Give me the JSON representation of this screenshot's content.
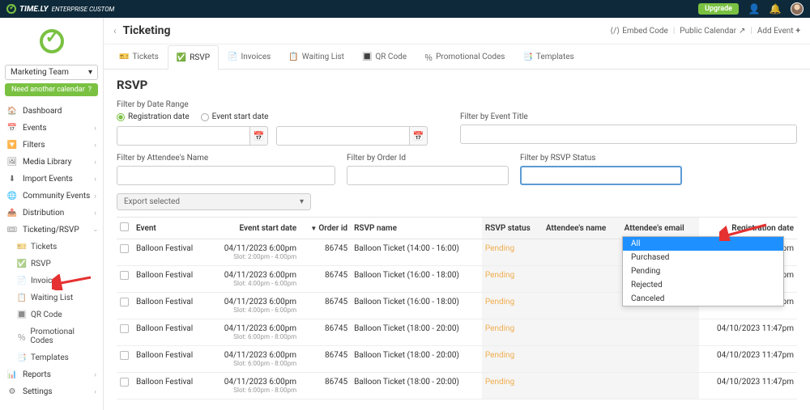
{
  "topbar": {
    "brand": "TIME.LY",
    "brand_sub": "ENTERPRISE CUSTOM",
    "upgrade": "Upgrade"
  },
  "sidebar": {
    "team": "Marketing Team",
    "need_calendar": "Need another calendar",
    "items": [
      {
        "icon": "🏠",
        "label": "Dashboard"
      },
      {
        "icon": "📅",
        "label": "Events",
        "chev": true
      },
      {
        "icon": "🔽",
        "label": "Filters",
        "chev": true
      },
      {
        "icon": "🖼",
        "label": "Media Library",
        "chev": true
      },
      {
        "icon": "⬇",
        "label": "Import Events",
        "chev": true
      },
      {
        "icon": "🌐",
        "label": "Community Events",
        "chev": true
      },
      {
        "icon": "📤",
        "label": "Distribution",
        "chev": true
      },
      {
        "icon": "🎟",
        "label": "Ticketing/RSVP",
        "chev": true,
        "expanded": true
      },
      {
        "icon": "📊",
        "label": "Reports",
        "chev": true
      },
      {
        "icon": "⚙",
        "label": "Settings",
        "chev": true
      }
    ],
    "sub_items": [
      {
        "icon": "🎫",
        "label": "Tickets"
      },
      {
        "icon": "✅",
        "label": "RSVP"
      },
      {
        "icon": "📄",
        "label": "Invoices"
      },
      {
        "icon": "📋",
        "label": "Waiting List"
      },
      {
        "icon": "🔳",
        "label": "QR Code"
      },
      {
        "icon": "％",
        "label": "Promotional Codes"
      },
      {
        "icon": "📑",
        "label": "Templates"
      }
    ]
  },
  "page": {
    "title": "Ticketing",
    "embed": "Embed Code",
    "public": "Public Calendar",
    "add": "Add Event"
  },
  "tabs": [
    {
      "icon": "🎫",
      "label": "Tickets"
    },
    {
      "icon": "✅",
      "label": "RSVP",
      "active": true
    },
    {
      "icon": "📄",
      "label": "Invoices"
    },
    {
      "icon": "📋",
      "label": "Waiting List"
    },
    {
      "icon": "🔳",
      "label": "QR Code"
    },
    {
      "icon": "％",
      "label": "Promotional Codes"
    },
    {
      "icon": "📑",
      "label": "Templates"
    }
  ],
  "filters": {
    "section": "RSVP",
    "date_range": "Filter by Date Range",
    "reg": "Registration date",
    "start": "Event start date",
    "event_title": "Filter by Event Title",
    "attendee": "Filter by Attendee's Name",
    "order": "Filter by Order Id",
    "status": "Filter by RSVP Status",
    "export": "Export selected",
    "status_options": [
      "All",
      "Purchased",
      "Pending",
      "Rejected",
      "Canceled"
    ]
  },
  "table": {
    "cols": [
      "",
      "Event",
      "Event start date",
      "Order id",
      "RSVP name",
      "RSVP status",
      "Attendee's name",
      "Attendee's email",
      "Registration date"
    ],
    "rows": [
      {
        "event": "Balloon Festival",
        "date": "04/11/2023 6:00pm",
        "slot": "Slot: 2:00pm - 4:00pm",
        "order": "86745",
        "rsvp": "Balloon Ticket (14:00 - 16:00)",
        "status": "Pending",
        "reg": "04/10/2023 11:47pm"
      },
      {
        "event": "Balloon Festival",
        "date": "04/11/2023 6:00pm",
        "slot": "Slot: 4:00pm - 6:00pm",
        "order": "86745",
        "rsvp": "Balloon Ticket (16:00 - 18:00)",
        "status": "Pending",
        "reg": "04/10/2023 11:47pm"
      },
      {
        "event": "Balloon Festival",
        "date": "04/11/2023 6:00pm",
        "slot": "Slot: 4:00pm - 6:00pm",
        "order": "86745",
        "rsvp": "Balloon Ticket (16:00 - 18:00)",
        "status": "Pending",
        "reg": "04/10/2023 11:47pm"
      },
      {
        "event": "Balloon Festival",
        "date": "04/11/2023 6:00pm",
        "slot": "Slot: 6:00pm - 8:00pm",
        "order": "86745",
        "rsvp": "Balloon Ticket (18:00 - 20:00)",
        "status": "Pending",
        "reg": "04/10/2023 11:47pm"
      },
      {
        "event": "Balloon Festival",
        "date": "04/11/2023 6:00pm",
        "slot": "Slot: 6:00pm - 8:00pm",
        "order": "86745",
        "rsvp": "Balloon Ticket (18:00 - 20:00)",
        "status": "Pending",
        "reg": "04/10/2023 11:47pm"
      },
      {
        "event": "Balloon Festival",
        "date": "04/11/2023 6:00pm",
        "slot": "Slot: 6:00pm - 8:00pm",
        "order": "86745",
        "rsvp": "Balloon Ticket (18:00 - 20:00)",
        "status": "Pending",
        "reg": "04/10/2023 11:47pm"
      }
    ]
  }
}
